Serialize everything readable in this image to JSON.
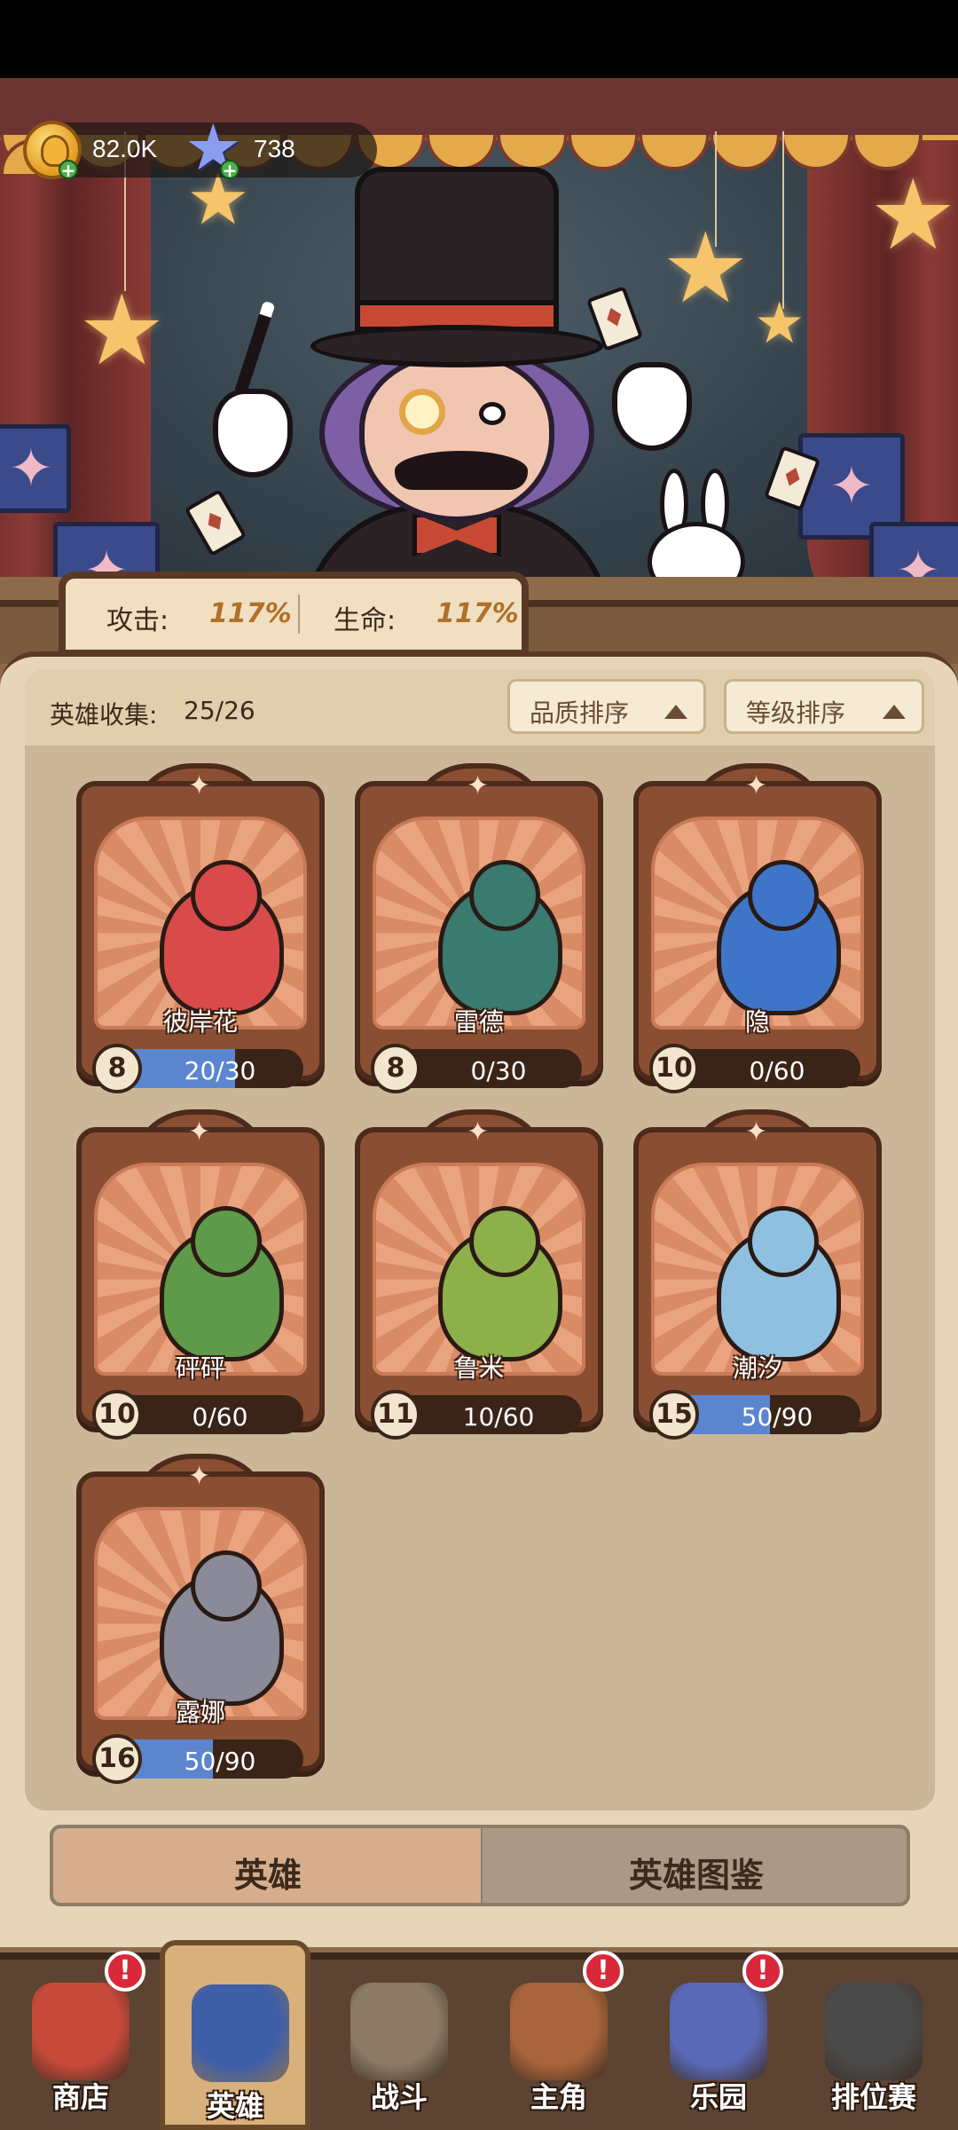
{
  "currency": {
    "coins": "82.0K",
    "stars": "738"
  },
  "stats": {
    "attack_label": "攻击:",
    "attack_value": "117%",
    "health_label": "生命:",
    "health_value": "117%"
  },
  "collection": {
    "label": "英雄收集:",
    "count": "25/26",
    "sort_quality": "品质排序",
    "sort_level": "等级排序"
  },
  "heroes": [
    {
      "name": "彼岸花",
      "level": "8",
      "progress": "20/30",
      "fill": 0.67,
      "color": "#d94a4a"
    },
    {
      "name": "雷德",
      "level": "8",
      "progress": "0/30",
      "fill": 0.0,
      "color": "#3b7a6e"
    },
    {
      "name": "隐",
      "level": "10",
      "progress": "0/60",
      "fill": 0.0,
      "color": "#3f75c8"
    },
    {
      "name": "砰砰",
      "level": "10",
      "progress": "0/60",
      "fill": 0.0,
      "color": "#5e9a4a"
    },
    {
      "name": "鲁米",
      "level": "11",
      "progress": "10/60",
      "fill": 0.17,
      "color": "#8db04a"
    },
    {
      "name": "潮汐",
      "level": "15",
      "progress": "50/90",
      "fill": 0.56,
      "color": "#8fc0e0"
    },
    {
      "name": "露娜",
      "level": "16",
      "progress": "50/90",
      "fill": 0.56,
      "color": "#8a8a98"
    }
  ],
  "tabs": {
    "heroes": "英雄",
    "codex": "英雄图鉴"
  },
  "nav": [
    {
      "label": "商店",
      "icon": "shop-icon",
      "alert": true,
      "color": "#c84a3a"
    },
    {
      "label": "英雄",
      "icon": "hero-cards-icon",
      "alert": false,
      "active": true,
      "color": "#3e5fa8"
    },
    {
      "label": "战斗",
      "icon": "battle-icon",
      "alert": false,
      "color": "#8c7a64"
    },
    {
      "label": "主角",
      "icon": "owl-icon",
      "alert": true,
      "color": "#a8643a"
    },
    {
      "label": "乐园",
      "icon": "castle-icon",
      "alert": true,
      "color": "#5a6ab8"
    },
    {
      "label": "排位赛",
      "icon": "lock-icon",
      "alert": false,
      "color": "#4a4a4a"
    }
  ],
  "alert_symbol": "!",
  "plus_symbol": "+"
}
